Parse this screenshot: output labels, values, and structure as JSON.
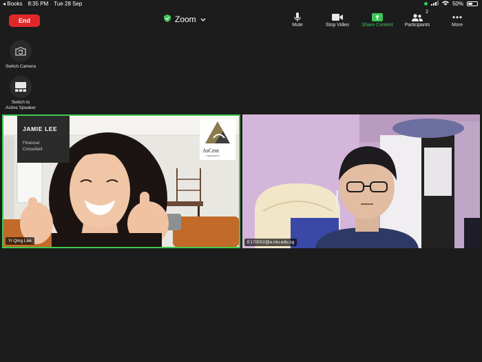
{
  "status_bar": {
    "back_app": "Books",
    "time": "8:35 PM",
    "date": "Tue 28 Sep",
    "battery": "50%",
    "battery_level": 0.5
  },
  "header": {
    "end_label": "End",
    "meeting_title": "Zoom",
    "colors": {
      "end": "#e02828",
      "share": "#3fc45a",
      "active_border": "#3ecb4f"
    }
  },
  "toolbar": {
    "mute_label": "Mute",
    "stop_video_label": "Stop Video",
    "share_content_label": "Share Content",
    "participants_label": "Participants",
    "participants_count": "2",
    "more_label": "More"
  },
  "side_controls": {
    "switch_camera_label": "Switch Camera",
    "switch_speaker_line1": "Switch to",
    "switch_speaker_line2": "Active Speaker"
  },
  "tiles": [
    {
      "name": "Yi Qing Lee",
      "banner_name": "JAMIE LEE",
      "banner_role_1": "Financial",
      "banner_role_2": "Consultant",
      "logo_text": "AsCent",
      "logo_subtext": "Organization"
    },
    {
      "name": "E170002@e.ntu.edu.sg"
    }
  ]
}
